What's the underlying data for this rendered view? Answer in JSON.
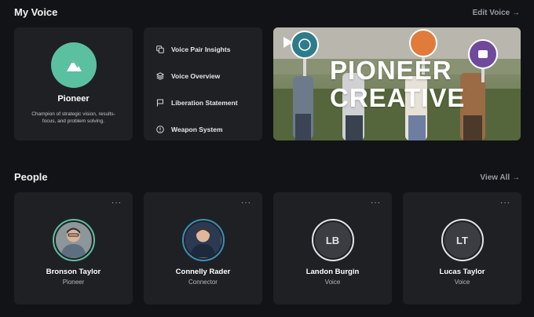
{
  "my_voice": {
    "title": "My Voice",
    "edit_link": "Edit Voice →"
  },
  "profile": {
    "name": "Pioneer",
    "description": "Champion of strategic vision, results-focus, and problem solving.",
    "badge_color": "#5bc0a0",
    "badge_icon": "mountain-icon"
  },
  "menu": {
    "items": [
      {
        "label": "Voice Pair Insights",
        "icon": "copy-icon"
      },
      {
        "label": "Voice Overview",
        "icon": "layers-icon"
      },
      {
        "label": "Liberation Statement",
        "icon": "flag-icon"
      },
      {
        "label": "Weapon System",
        "icon": "alert-circle-icon"
      }
    ]
  },
  "video": {
    "title_line1": "PIONEER",
    "title_line2": "CREATIVE",
    "play_icon": "play-icon"
  },
  "people": {
    "title": "People",
    "view_all": "View All →",
    "more_label": "···",
    "cards": [
      {
        "name": "Bronson Taylor",
        "role": "Pioneer",
        "ring_color": "#5bc0a0"
      },
      {
        "name": "Connelly Rader",
        "role": "Connector",
        "ring_color": "#3a8fb7"
      },
      {
        "name": "Landon Burgin",
        "role": "Voice",
        "initials": "LB",
        "ring_color": "#e4e4e6"
      },
      {
        "name": "Lucas Taylor",
        "role": "Voice",
        "initials": "LT",
        "ring_color": "#e4e4e6"
      }
    ]
  }
}
